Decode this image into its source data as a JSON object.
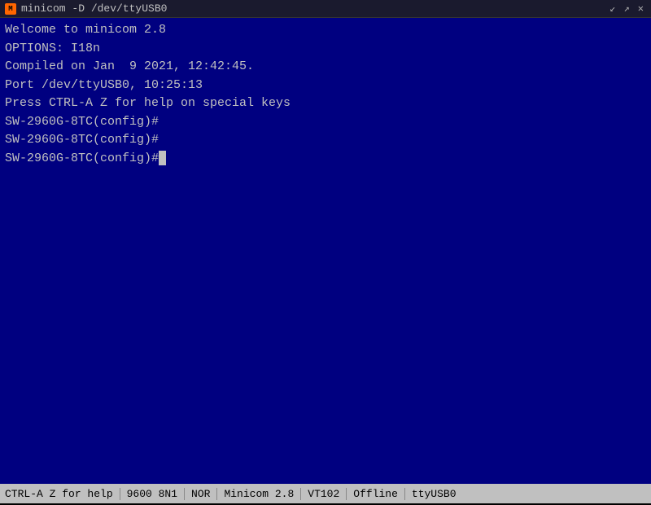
{
  "titlebar": {
    "title": "minicom -D /dev/ttyUSB0",
    "icon": "M",
    "btn_minimize": "↙",
    "btn_maximize": "↗",
    "btn_close": "✕"
  },
  "terminal": {
    "lines": [
      "",
      "Welcome to minicom 2.8",
      "",
      "OPTIONS: I18n",
      "Compiled on Jan  9 2021, 12:42:45.",
      "Port /dev/ttyUSB0, 10:25:13",
      "",
      "Press CTRL-A Z for help on special keys",
      "",
      "",
      "",
      "",
      "",
      "SW-2960G-8TC(config)#",
      "SW-2960G-8TC(config)#",
      "SW-2960G-8TC(config)#"
    ]
  },
  "statusbar": {
    "help": "CTRL-A Z for help",
    "baud": "9600 8N1",
    "flow": "NOR",
    "app": "Minicom 2.8",
    "terminal": "VT102",
    "status": "Offline",
    "port": "ttyUSB0"
  }
}
